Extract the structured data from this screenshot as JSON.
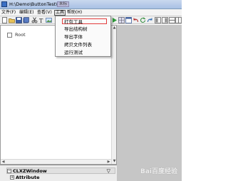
{
  "window": {
    "title": "H:\\Demo\\ButtonTest\\",
    "tag": "未标"
  },
  "menubar": {
    "items": [
      {
        "label": "文件(F)"
      },
      {
        "label": "编辑(E)"
      },
      {
        "label": "查看(V)"
      },
      {
        "label": "工具"
      },
      {
        "label": "帮助(H)"
      }
    ]
  },
  "dropdown": {
    "items": [
      {
        "label": "打包工具"
      },
      {
        "label": "导出结构树"
      },
      {
        "label": "导出字体"
      },
      {
        "label": "拷贝文件列表"
      },
      {
        "label": "运行测试"
      }
    ]
  },
  "tree": {
    "root_label": "Root"
  },
  "properties": {
    "row1_label": "CLXZWindow",
    "row1_chevron": "▽",
    "row2_label": "Attribute"
  },
  "watermark": "Bai百度经验",
  "colors": {
    "highlight_border": "#e23b3b",
    "right_panel": "#c6c6c6"
  }
}
